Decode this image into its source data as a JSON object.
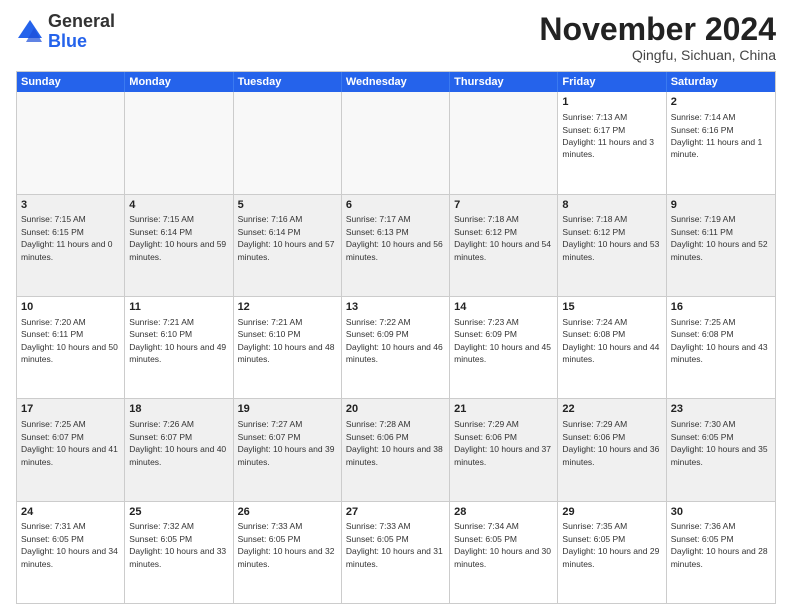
{
  "logo": {
    "general": "General",
    "blue": "Blue"
  },
  "header": {
    "month": "November 2024",
    "location": "Qingfu, Sichuan, China"
  },
  "days_of_week": [
    "Sunday",
    "Monday",
    "Tuesday",
    "Wednesday",
    "Thursday",
    "Friday",
    "Saturday"
  ],
  "weeks": [
    [
      {
        "day": "",
        "empty": true
      },
      {
        "day": "",
        "empty": true
      },
      {
        "day": "",
        "empty": true
      },
      {
        "day": "",
        "empty": true
      },
      {
        "day": "",
        "empty": true
      },
      {
        "day": "1",
        "sunrise": "7:13 AM",
        "sunset": "6:17 PM",
        "daylight": "11 hours and 3 minutes."
      },
      {
        "day": "2",
        "sunrise": "7:14 AM",
        "sunset": "6:16 PM",
        "daylight": "11 hours and 1 minute."
      }
    ],
    [
      {
        "day": "3",
        "sunrise": "7:15 AM",
        "sunset": "6:15 PM",
        "daylight": "11 hours and 0 minutes."
      },
      {
        "day": "4",
        "sunrise": "7:15 AM",
        "sunset": "6:14 PM",
        "daylight": "10 hours and 59 minutes."
      },
      {
        "day": "5",
        "sunrise": "7:16 AM",
        "sunset": "6:14 PM",
        "daylight": "10 hours and 57 minutes."
      },
      {
        "day": "6",
        "sunrise": "7:17 AM",
        "sunset": "6:13 PM",
        "daylight": "10 hours and 56 minutes."
      },
      {
        "day": "7",
        "sunrise": "7:18 AM",
        "sunset": "6:12 PM",
        "daylight": "10 hours and 54 minutes."
      },
      {
        "day": "8",
        "sunrise": "7:18 AM",
        "sunset": "6:12 PM",
        "daylight": "10 hours and 53 minutes."
      },
      {
        "day": "9",
        "sunrise": "7:19 AM",
        "sunset": "6:11 PM",
        "daylight": "10 hours and 52 minutes."
      }
    ],
    [
      {
        "day": "10",
        "sunrise": "7:20 AM",
        "sunset": "6:11 PM",
        "daylight": "10 hours and 50 minutes."
      },
      {
        "day": "11",
        "sunrise": "7:21 AM",
        "sunset": "6:10 PM",
        "daylight": "10 hours and 49 minutes."
      },
      {
        "day": "12",
        "sunrise": "7:21 AM",
        "sunset": "6:10 PM",
        "daylight": "10 hours and 48 minutes."
      },
      {
        "day": "13",
        "sunrise": "7:22 AM",
        "sunset": "6:09 PM",
        "daylight": "10 hours and 46 minutes."
      },
      {
        "day": "14",
        "sunrise": "7:23 AM",
        "sunset": "6:09 PM",
        "daylight": "10 hours and 45 minutes."
      },
      {
        "day": "15",
        "sunrise": "7:24 AM",
        "sunset": "6:08 PM",
        "daylight": "10 hours and 44 minutes."
      },
      {
        "day": "16",
        "sunrise": "7:25 AM",
        "sunset": "6:08 PM",
        "daylight": "10 hours and 43 minutes."
      }
    ],
    [
      {
        "day": "17",
        "sunrise": "7:25 AM",
        "sunset": "6:07 PM",
        "daylight": "10 hours and 41 minutes."
      },
      {
        "day": "18",
        "sunrise": "7:26 AM",
        "sunset": "6:07 PM",
        "daylight": "10 hours and 40 minutes."
      },
      {
        "day": "19",
        "sunrise": "7:27 AM",
        "sunset": "6:07 PM",
        "daylight": "10 hours and 39 minutes."
      },
      {
        "day": "20",
        "sunrise": "7:28 AM",
        "sunset": "6:06 PM",
        "daylight": "10 hours and 38 minutes."
      },
      {
        "day": "21",
        "sunrise": "7:29 AM",
        "sunset": "6:06 PM",
        "daylight": "10 hours and 37 minutes."
      },
      {
        "day": "22",
        "sunrise": "7:29 AM",
        "sunset": "6:06 PM",
        "daylight": "10 hours and 36 minutes."
      },
      {
        "day": "23",
        "sunrise": "7:30 AM",
        "sunset": "6:05 PM",
        "daylight": "10 hours and 35 minutes."
      }
    ],
    [
      {
        "day": "24",
        "sunrise": "7:31 AM",
        "sunset": "6:05 PM",
        "daylight": "10 hours and 34 minutes."
      },
      {
        "day": "25",
        "sunrise": "7:32 AM",
        "sunset": "6:05 PM",
        "daylight": "10 hours and 33 minutes."
      },
      {
        "day": "26",
        "sunrise": "7:33 AM",
        "sunset": "6:05 PM",
        "daylight": "10 hours and 32 minutes."
      },
      {
        "day": "27",
        "sunrise": "7:33 AM",
        "sunset": "6:05 PM",
        "daylight": "10 hours and 31 minutes."
      },
      {
        "day": "28",
        "sunrise": "7:34 AM",
        "sunset": "6:05 PM",
        "daylight": "10 hours and 30 minutes."
      },
      {
        "day": "29",
        "sunrise": "7:35 AM",
        "sunset": "6:05 PM",
        "daylight": "10 hours and 29 minutes."
      },
      {
        "day": "30",
        "sunrise": "7:36 AM",
        "sunset": "6:05 PM",
        "daylight": "10 hours and 28 minutes."
      }
    ]
  ],
  "labels": {
    "sunrise": "Sunrise:",
    "sunset": "Sunset:",
    "daylight": "Daylight:"
  }
}
